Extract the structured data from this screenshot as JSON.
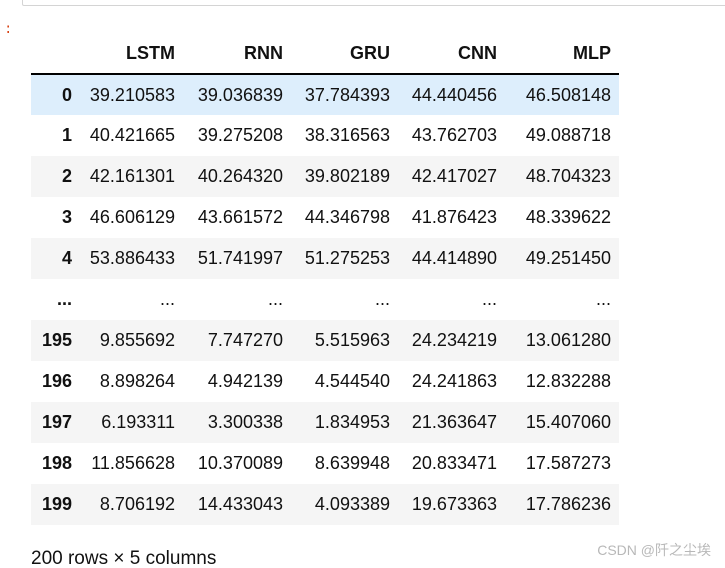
{
  "prompt": ":",
  "table": {
    "columns": [
      "LSTM",
      "RNN",
      "GRU",
      "CNN",
      "MLP"
    ],
    "rows": [
      {
        "index": "0",
        "values": [
          "39.210583",
          "39.036839",
          "37.784393",
          "44.440456",
          "46.508148"
        ]
      },
      {
        "index": "1",
        "values": [
          "40.421665",
          "39.275208",
          "38.316563",
          "43.762703",
          "49.088718"
        ]
      },
      {
        "index": "2",
        "values": [
          "42.161301",
          "40.264320",
          "39.802189",
          "42.417027",
          "48.704323"
        ]
      },
      {
        "index": "3",
        "values": [
          "46.606129",
          "43.661572",
          "44.346798",
          "41.876423",
          "48.339622"
        ]
      },
      {
        "index": "4",
        "values": [
          "53.886433",
          "51.741997",
          "51.275253",
          "44.414890",
          "49.251450"
        ]
      },
      {
        "index": "...",
        "values": [
          "...",
          "...",
          "...",
          "...",
          "..."
        ]
      },
      {
        "index": "195",
        "values": [
          "9.855692",
          "7.747270",
          "5.515963",
          "24.234219",
          "13.061280"
        ]
      },
      {
        "index": "196",
        "values": [
          "8.898264",
          "4.942139",
          "4.544540",
          "24.241863",
          "12.832288"
        ]
      },
      {
        "index": "197",
        "values": [
          "6.193311",
          "3.300338",
          "1.834953",
          "21.363647",
          "15.407060"
        ]
      },
      {
        "index": "198",
        "values": [
          "11.856628",
          "10.370089",
          "8.639948",
          "20.833471",
          "17.587273"
        ]
      },
      {
        "index": "199",
        "values": [
          "8.706192",
          "14.433043",
          "4.093389",
          "19.673363",
          "17.786236"
        ]
      }
    ]
  },
  "footer": "200 rows × 5 columns",
  "watermark": "CSDN @阡之尘埃"
}
